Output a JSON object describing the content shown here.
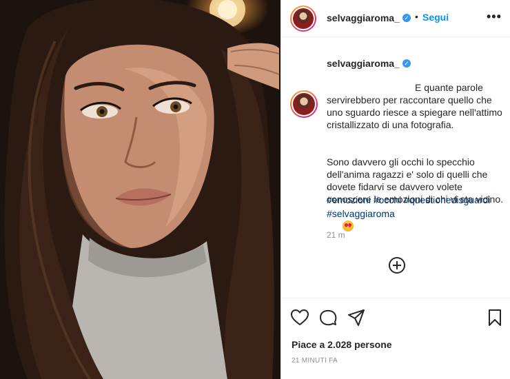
{
  "post": {
    "username": "selvaggiaroma_",
    "follow_label": "Segui",
    "dot": "•",
    "more_label": "•••",
    "caption_first": "E quante parole servirebbero per raccontare quello che uno sguardo riesce a spiegare nell'attimo cristallizzato di una fotografia.",
    "caption_second": "Sono davvero gli occhi lo specchio dell'anima ragazzi e' solo di quelli che dovete fidarvi se davvero volete conoscere le emozioni di chi vi sta vicino.",
    "period": ".",
    "hashtags": [
      "#emozioni",
      "#occhi",
      "#questionedisguardi",
      "#selvaggiaroma"
    ],
    "caption_time": "21 m",
    "likes": "Piace a 2.028 persone",
    "timestamp": "21 MINUTI FA"
  },
  "icons": {
    "verified": "verified-badge-icon",
    "like": "heart-icon",
    "comment": "comment-icon",
    "share": "send-icon",
    "save": "bookmark-icon",
    "more_comments": "plus-circle-icon"
  },
  "colors": {
    "link_blue": "#0095f6",
    "hashtag": "#00376b",
    "verified": "#3897f0",
    "muted": "#8e8e8e"
  }
}
